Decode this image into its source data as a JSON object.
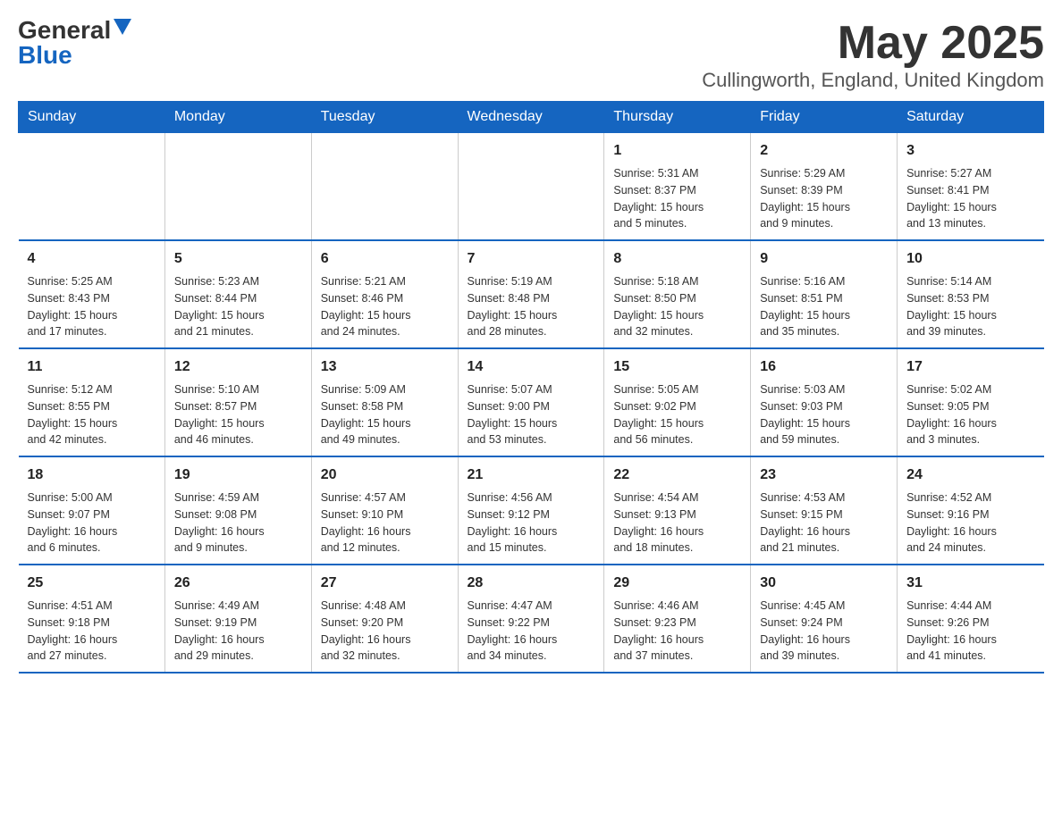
{
  "logo": {
    "part1": "General",
    "part2": "Blue"
  },
  "title": "May 2025",
  "subtitle": "Cullingworth, England, United Kingdom",
  "headers": [
    "Sunday",
    "Monday",
    "Tuesday",
    "Wednesday",
    "Thursday",
    "Friday",
    "Saturday"
  ],
  "weeks": [
    [
      {
        "day": "",
        "info": ""
      },
      {
        "day": "",
        "info": ""
      },
      {
        "day": "",
        "info": ""
      },
      {
        "day": "",
        "info": ""
      },
      {
        "day": "1",
        "info": "Sunrise: 5:31 AM\nSunset: 8:37 PM\nDaylight: 15 hours\nand 5 minutes."
      },
      {
        "day": "2",
        "info": "Sunrise: 5:29 AM\nSunset: 8:39 PM\nDaylight: 15 hours\nand 9 minutes."
      },
      {
        "day": "3",
        "info": "Sunrise: 5:27 AM\nSunset: 8:41 PM\nDaylight: 15 hours\nand 13 minutes."
      }
    ],
    [
      {
        "day": "4",
        "info": "Sunrise: 5:25 AM\nSunset: 8:43 PM\nDaylight: 15 hours\nand 17 minutes."
      },
      {
        "day": "5",
        "info": "Sunrise: 5:23 AM\nSunset: 8:44 PM\nDaylight: 15 hours\nand 21 minutes."
      },
      {
        "day": "6",
        "info": "Sunrise: 5:21 AM\nSunset: 8:46 PM\nDaylight: 15 hours\nand 24 minutes."
      },
      {
        "day": "7",
        "info": "Sunrise: 5:19 AM\nSunset: 8:48 PM\nDaylight: 15 hours\nand 28 minutes."
      },
      {
        "day": "8",
        "info": "Sunrise: 5:18 AM\nSunset: 8:50 PM\nDaylight: 15 hours\nand 32 minutes."
      },
      {
        "day": "9",
        "info": "Sunrise: 5:16 AM\nSunset: 8:51 PM\nDaylight: 15 hours\nand 35 minutes."
      },
      {
        "day": "10",
        "info": "Sunrise: 5:14 AM\nSunset: 8:53 PM\nDaylight: 15 hours\nand 39 minutes."
      }
    ],
    [
      {
        "day": "11",
        "info": "Sunrise: 5:12 AM\nSunset: 8:55 PM\nDaylight: 15 hours\nand 42 minutes."
      },
      {
        "day": "12",
        "info": "Sunrise: 5:10 AM\nSunset: 8:57 PM\nDaylight: 15 hours\nand 46 minutes."
      },
      {
        "day": "13",
        "info": "Sunrise: 5:09 AM\nSunset: 8:58 PM\nDaylight: 15 hours\nand 49 minutes."
      },
      {
        "day": "14",
        "info": "Sunrise: 5:07 AM\nSunset: 9:00 PM\nDaylight: 15 hours\nand 53 minutes."
      },
      {
        "day": "15",
        "info": "Sunrise: 5:05 AM\nSunset: 9:02 PM\nDaylight: 15 hours\nand 56 minutes."
      },
      {
        "day": "16",
        "info": "Sunrise: 5:03 AM\nSunset: 9:03 PM\nDaylight: 15 hours\nand 59 minutes."
      },
      {
        "day": "17",
        "info": "Sunrise: 5:02 AM\nSunset: 9:05 PM\nDaylight: 16 hours\nand 3 minutes."
      }
    ],
    [
      {
        "day": "18",
        "info": "Sunrise: 5:00 AM\nSunset: 9:07 PM\nDaylight: 16 hours\nand 6 minutes."
      },
      {
        "day": "19",
        "info": "Sunrise: 4:59 AM\nSunset: 9:08 PM\nDaylight: 16 hours\nand 9 minutes."
      },
      {
        "day": "20",
        "info": "Sunrise: 4:57 AM\nSunset: 9:10 PM\nDaylight: 16 hours\nand 12 minutes."
      },
      {
        "day": "21",
        "info": "Sunrise: 4:56 AM\nSunset: 9:12 PM\nDaylight: 16 hours\nand 15 minutes."
      },
      {
        "day": "22",
        "info": "Sunrise: 4:54 AM\nSunset: 9:13 PM\nDaylight: 16 hours\nand 18 minutes."
      },
      {
        "day": "23",
        "info": "Sunrise: 4:53 AM\nSunset: 9:15 PM\nDaylight: 16 hours\nand 21 minutes."
      },
      {
        "day": "24",
        "info": "Sunrise: 4:52 AM\nSunset: 9:16 PM\nDaylight: 16 hours\nand 24 minutes."
      }
    ],
    [
      {
        "day": "25",
        "info": "Sunrise: 4:51 AM\nSunset: 9:18 PM\nDaylight: 16 hours\nand 27 minutes."
      },
      {
        "day": "26",
        "info": "Sunrise: 4:49 AM\nSunset: 9:19 PM\nDaylight: 16 hours\nand 29 minutes."
      },
      {
        "day": "27",
        "info": "Sunrise: 4:48 AM\nSunset: 9:20 PM\nDaylight: 16 hours\nand 32 minutes."
      },
      {
        "day": "28",
        "info": "Sunrise: 4:47 AM\nSunset: 9:22 PM\nDaylight: 16 hours\nand 34 minutes."
      },
      {
        "day": "29",
        "info": "Sunrise: 4:46 AM\nSunset: 9:23 PM\nDaylight: 16 hours\nand 37 minutes."
      },
      {
        "day": "30",
        "info": "Sunrise: 4:45 AM\nSunset: 9:24 PM\nDaylight: 16 hours\nand 39 minutes."
      },
      {
        "day": "31",
        "info": "Sunrise: 4:44 AM\nSunset: 9:26 PM\nDaylight: 16 hours\nand 41 minutes."
      }
    ]
  ]
}
